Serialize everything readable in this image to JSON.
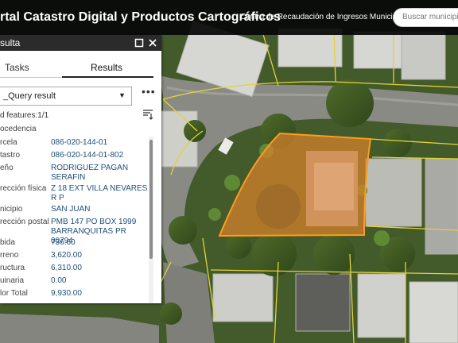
{
  "header": {
    "title": "rtal Catastro Digital y Productos Cartográficos",
    "subtitle": "Centro de Recaudación de Ingresos Municipales",
    "search_placeholder": "Buscar municipio o"
  },
  "panel": {
    "title": "sulta",
    "tabs": [
      "Tasks",
      "Results"
    ],
    "active_tab": "Results",
    "layer_select": "_Query result",
    "features_label": "d features:1/1",
    "attributes": [
      {
        "label": "ocedencia",
        "value": ""
      },
      {
        "label": "rcela",
        "value": "086-020-144-01"
      },
      {
        "label": "tastro",
        "value": "086-020-144-01-802"
      },
      {
        "label": "eño",
        "value": "RODRIGUEZ PAGAN SERAFIN"
      },
      {
        "label": "rección física",
        "value": "Z 18 EXT VILLA NEVARES R P"
      },
      {
        "label": "nicipio",
        "value": "SAN JUAN"
      },
      {
        "label": "rección postal",
        "value": "PMB 147 PO BOX 1999 BARRANQUITAS PR 00794"
      },
      {
        "label": "bida",
        "value": "736.60"
      },
      {
        "label": "rreno",
        "value": "3,620.00"
      },
      {
        "label": "ructura",
        "value": "6,310.00"
      },
      {
        "label": "uinaria",
        "value": "0.00"
      },
      {
        "label": "lor Total",
        "value": "9,930.00"
      }
    ]
  },
  "icons": {
    "maximize": "maximize-icon",
    "close": "close-icon",
    "more": "more-options-icon",
    "sort": "sort-icon",
    "caret": "chevron-down-icon"
  },
  "colors": {
    "header_bg": "#080808",
    "parcel_fill": "#d9822b",
    "parcel_outline": "#ff9a1f",
    "parcel_lines": "#e3d23a",
    "value_text": "#1d4f7a"
  }
}
